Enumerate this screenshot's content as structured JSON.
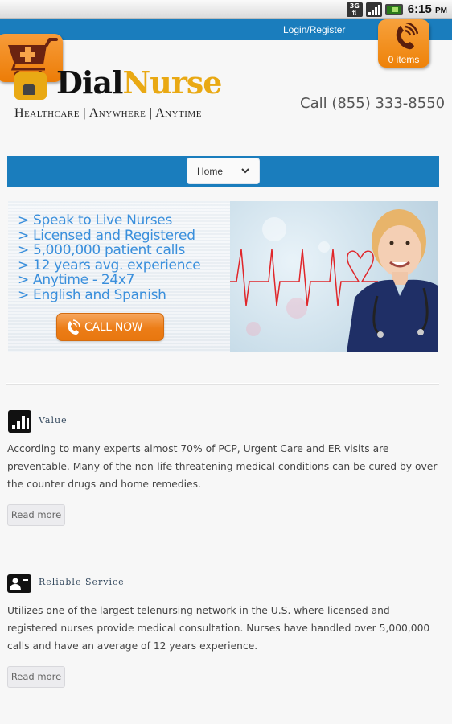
{
  "status_bar": {
    "network": "3G",
    "time": "6:15",
    "ampm": "PM"
  },
  "header": {
    "login_link": "Login/Register",
    "cart_count": "0 items",
    "logo_dial": "Dial",
    "logo_nurse": "Nurse",
    "tagline": "Healthcare | Anywhere | Anytime",
    "call_number": "Call (855) 333-8550",
    "brand_colors": {
      "blue": "#1a7dbd",
      "orange": "#ee8209",
      "gold": "#e9a914"
    }
  },
  "nav": {
    "selected": "Home"
  },
  "banner": {
    "lines": [
      "> Speak to Live Nurses",
      "> Licensed and Registered",
      "> 5,000,000 patient calls",
      "> 12 years avg. experience",
      "> Anytime - 24x7",
      "> English and Spanish"
    ],
    "cta": "CALL NOW"
  },
  "features": [
    {
      "icon": "bar-chart-icon",
      "title": "Value",
      "text": "According to many experts almost 70% of PCP, Urgent Care and ER visits are preventable. Many of the non-life threatening medical conditions can be cured by over the counter drugs and home remedies.",
      "button": "Read more"
    },
    {
      "icon": "id-card-icon",
      "title": "Reliable Service",
      "text": "Utilizes one of the largest telenursing network in the U.S. where licensed and registered nurses provide medical consultation. Nurses have handled over 5,000,000 calls and have an average of 12 years experience.",
      "button": "Read more"
    }
  ]
}
